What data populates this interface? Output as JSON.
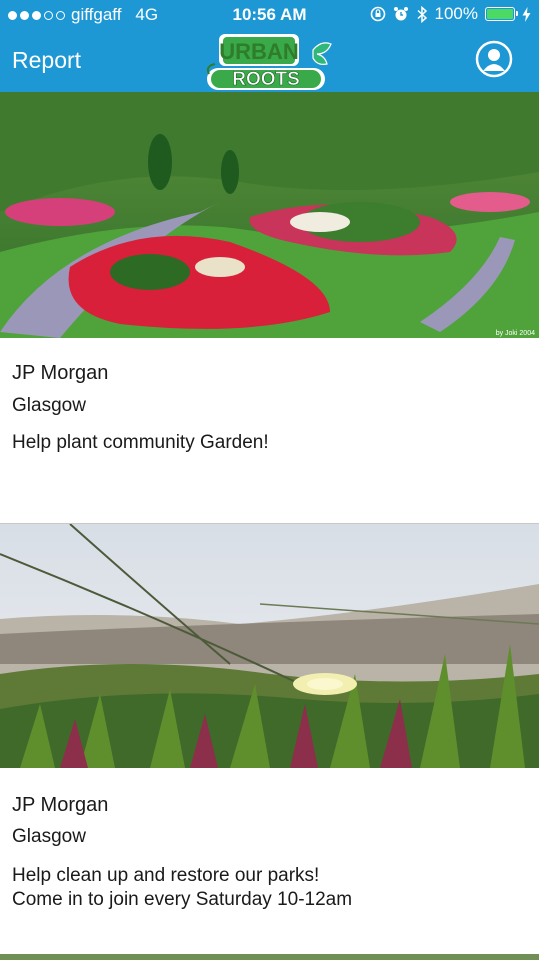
{
  "status_bar": {
    "carrier": "giffgaff",
    "network": "4G",
    "time": "10:56 AM",
    "battery": "100%"
  },
  "nav": {
    "left_label": "Report",
    "logo_top": "URBAN",
    "logo_bottom": "ROOTS"
  },
  "cards": [
    {
      "org": "JP Morgan",
      "location": "Glasgow",
      "description": "Help plant community Garden!",
      "photo_credit": "by Joki 2004"
    },
    {
      "org": "JP Morgan",
      "location": "Glasgow",
      "description_line1": "Help clean up and restore our parks!",
      "description_line2": "Come in to join every Saturday 10-12am"
    }
  ],
  "colors": {
    "header": "#1e98d5",
    "logo_green": "#3aa94a",
    "text": "#1a1a1a"
  }
}
